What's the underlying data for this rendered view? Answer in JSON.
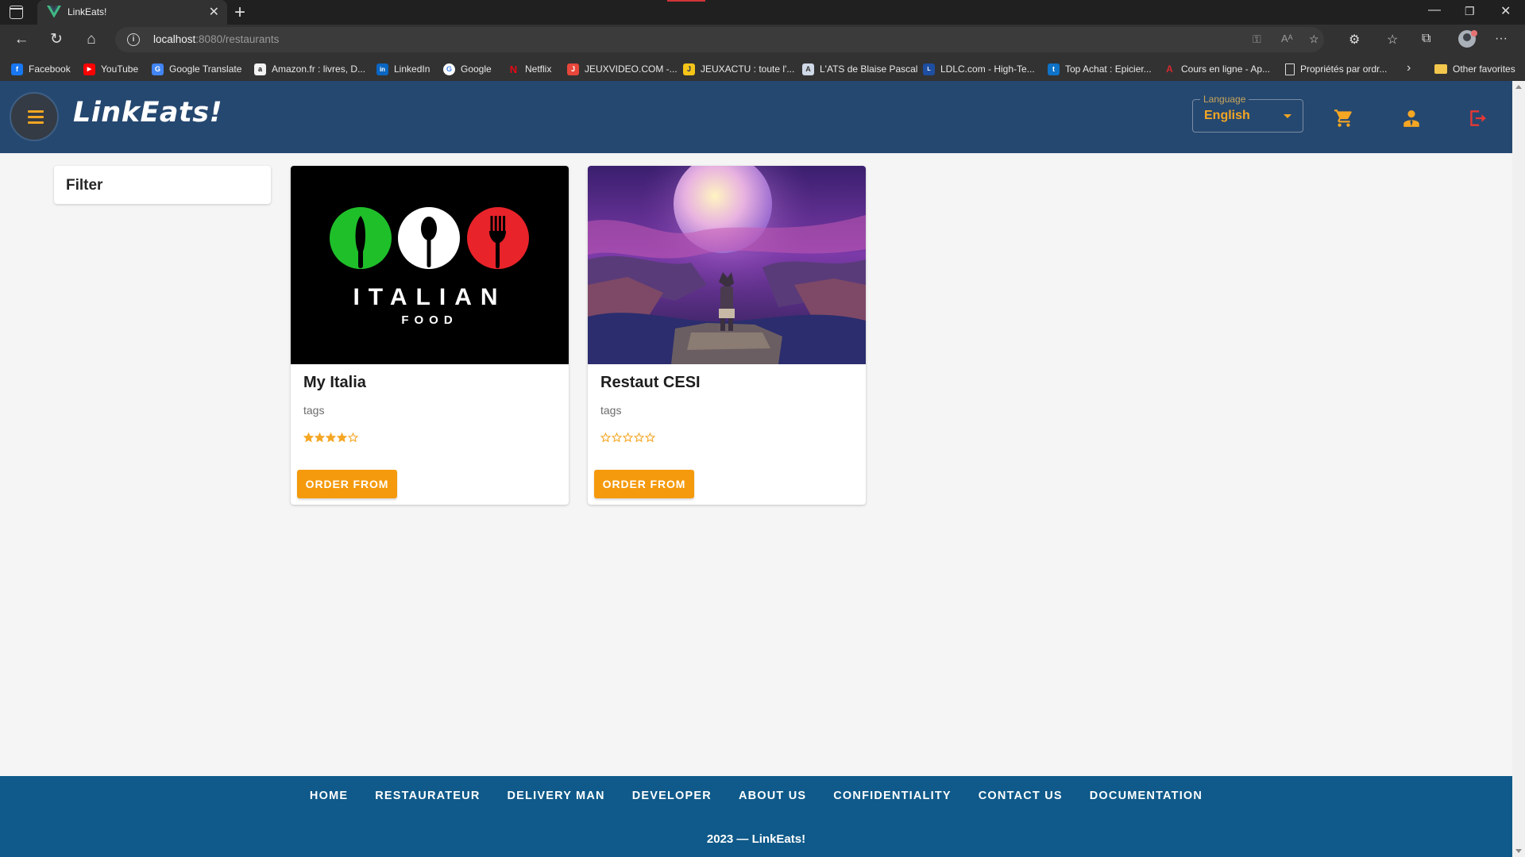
{
  "browser": {
    "tab_title": "LinkEats!",
    "url_host": "localhost",
    "url_path": ":8080/restaurants",
    "bookmarks": [
      {
        "label": "Facebook",
        "icon": "facebook-icon",
        "color": "#1877f2",
        "glyph": "f"
      },
      {
        "label": "YouTube",
        "icon": "youtube-icon",
        "color": "#ff0000",
        "glyph": "▶"
      },
      {
        "label": "Google Translate",
        "icon": "google-translate-icon",
        "color": "#4285f4",
        "glyph": "G"
      },
      {
        "label": "Amazon.fr : livres, D...",
        "icon": "amazon-icon",
        "color": "#f2f2f2",
        "glyph": "a"
      },
      {
        "label": "LinkedIn",
        "icon": "linkedin-icon",
        "color": "#0a66c2",
        "glyph": "in"
      },
      {
        "label": "Google",
        "icon": "google-icon",
        "color": "#ffffff",
        "glyph": "G"
      },
      {
        "label": "Netflix",
        "icon": "netflix-icon",
        "color": "#e50914",
        "glyph": "N"
      },
      {
        "label": "JEUXVIDEO.COM -...",
        "icon": "jeuxvideo-icon",
        "color": "#e8463a",
        "glyph": "J"
      },
      {
        "label": "JEUXACTU : toute l'...",
        "icon": "jeuxactu-icon",
        "color": "#f5c518",
        "glyph": "J"
      },
      {
        "label": "L'ATS de Blaise Pascal",
        "icon": "ats-icon",
        "color": "#cfd8e6",
        "glyph": "A"
      },
      {
        "label": "LDLC.com - High-Te...",
        "icon": "ldlc-icon",
        "color": "#1d4ea1",
        "glyph": "L"
      },
      {
        "label": "Top Achat : Epicier...",
        "icon": "topachat-icon",
        "color": "#0e72c7",
        "glyph": "t"
      },
      {
        "label": "Cours en ligne - Ap...",
        "icon": "cours-icon",
        "color": "#d7282f",
        "glyph": "A"
      },
      {
        "label": "Propriétés par ordr...",
        "icon": "page-icon",
        "color": "#323232",
        "glyph": "▯"
      }
    ],
    "other_favorites": "Other favorites"
  },
  "header": {
    "logo": "LinkEats!",
    "language_label": "Language",
    "language_value": "English"
  },
  "filter": {
    "title": "Filter"
  },
  "restaurants": [
    {
      "name": "My Italia",
      "tags": "tags",
      "rating": 4,
      "max_rating": 5,
      "button": "ORDER FROM",
      "image_text": "ITALIAN",
      "image_subtext": "FOOD"
    },
    {
      "name": "Restaut CESI",
      "tags": "tags",
      "rating": 0,
      "max_rating": 5,
      "button": "ORDER FROM"
    }
  ],
  "footer": {
    "links": [
      "HOME",
      "RESTAURATEUR",
      "DELIVERY MAN",
      "DEVELOPER",
      "ABOUT US",
      "CONFIDENTIALITY",
      "CONTACT US",
      "DOCUMENTATION"
    ],
    "copyright": "2023 — LinkEats!"
  },
  "colors": {
    "header_bg": "#254870",
    "accent": "#f5a623",
    "footer_bg": "#0f5a8a",
    "logout": "#e53935"
  }
}
